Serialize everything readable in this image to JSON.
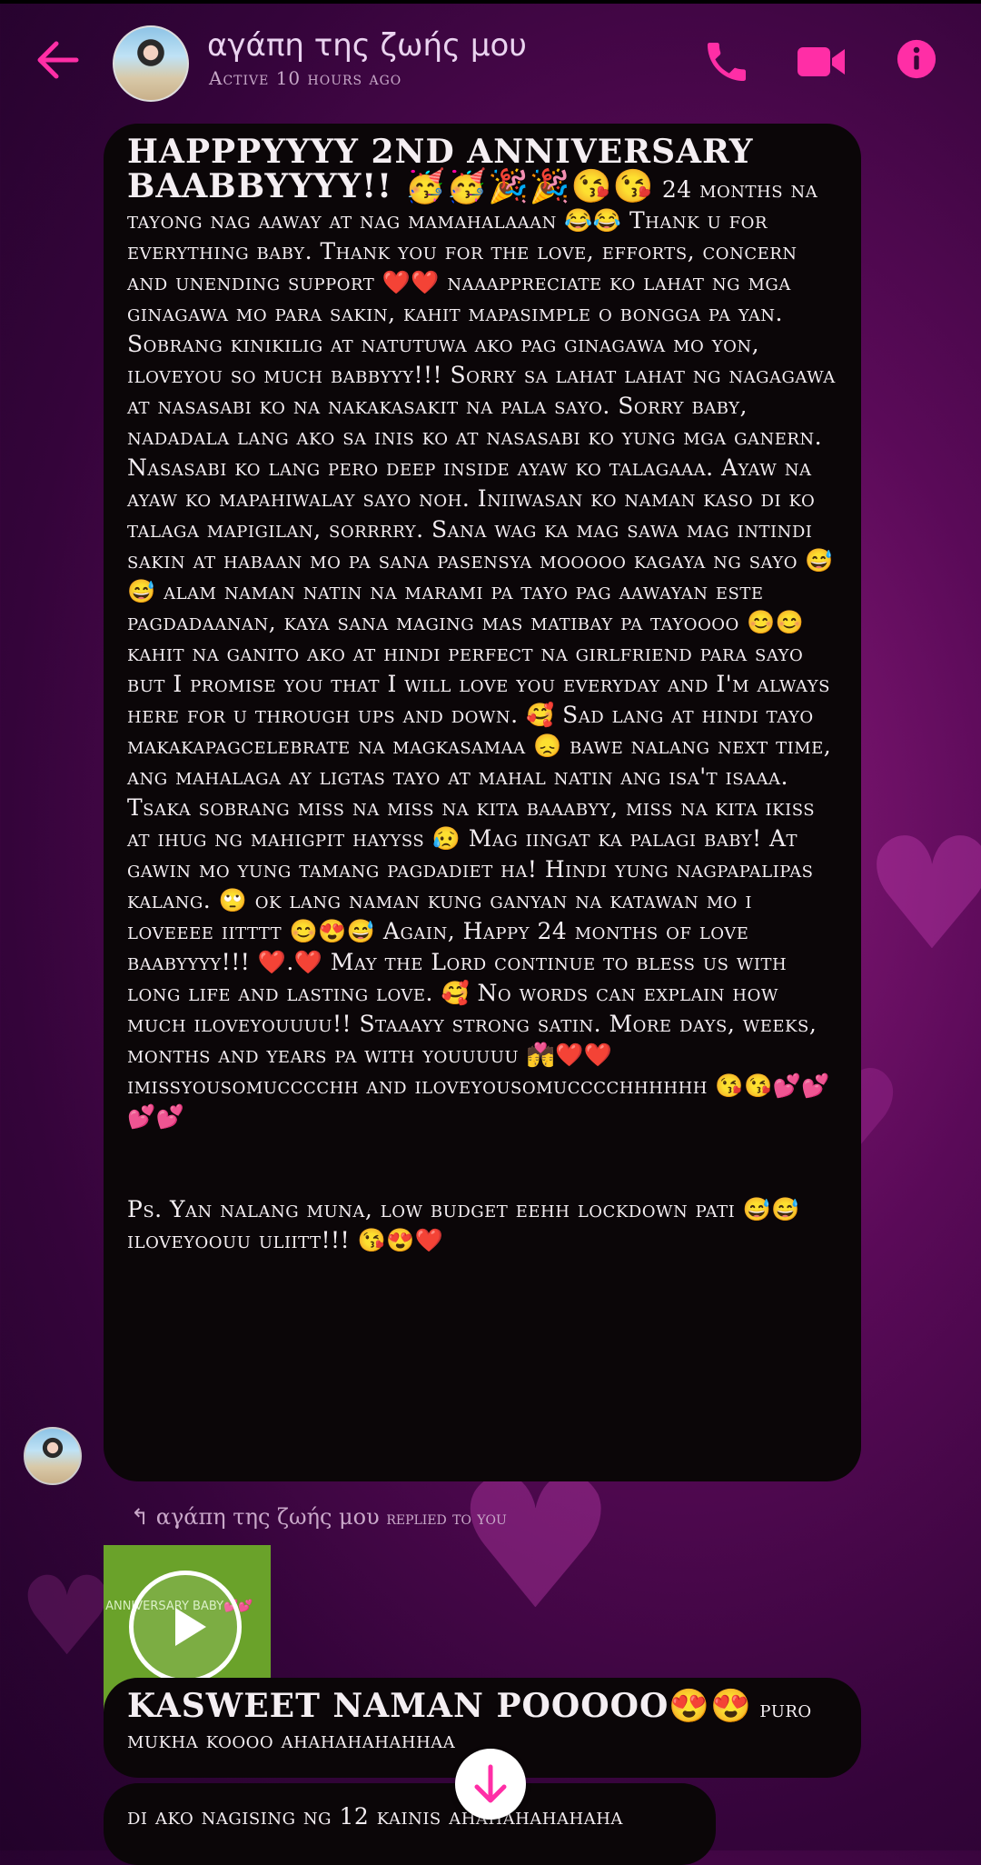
{
  "header": {
    "contact_name": "αγάπη της ζωής μου",
    "status": "Active 10 hours ago",
    "accent_color": "#ff2ea6"
  },
  "messages": {
    "anniversary": {
      "heading": "HAPPPYYYY 2ND ANNIVERSARY BAABBYYYY!! 🥳🥳🎉🎉😘😘",
      "body": " 24 months na tayong nag aaway at nag mamahalaaan 😂😂 Thank u for everything baby. Thank you for the love, efforts, concern and unending support ❤️❤️ naaappreciate ko lahat ng mga ginagawa mo para sakin, kahit mapasimple o bongga pa yan. Sobrang kinikilig at natutuwa ako pag ginagawa mo yon, iloveyou so much babbyyy!!! Sorry sa lahat lahat ng nagagawa at nasasabi ko na nakakasakit na pala sayo. Sorry baby, nadadala lang ako sa inis ko at nasasabi ko yung mga ganern. Nasasabi ko lang pero deep inside ayaw ko talagaaa. Ayaw na ayaw ko mapahiwalay sayo noh. Iniiwasan ko naman kaso di ko talaga mapigilan, sorrrry. Sana wag ka mag sawa mag intindi sakin at habaan mo pa sana pasensya mooooo kagaya ng sayo 😅😅 alam naman natin na marami pa tayo pag aawayan este pagdadaanan, kaya sana maging mas matibay pa tayoooo 😊😊 kahit na ganito ako at hindi perfect na girlfriend para sayo but I promise you that I will love you everyday and I'm always here for u through ups and down. 🥰 Sad lang at hindi tayo makakapagcelebrate na magkasamaa 😞 bawe nalang next time, ang mahalaga ay ligtas tayo at mahal natin ang isa't isaaa. Tsaka sobrang miss na miss na kita baaabyy, miss na kita ikiss at ihug ng mahigpit hayyss 😥 Mag iingat ka palagi baby! At gawin mo yung tamang pagdadiet ha! Hindi yung nagpapalipas kalang. 🙄 ok lang naman kung ganyan na katawan mo i loveeee iitttt 😊😍😅 Again, Happy 24 months of love baabyyyy!!! ❤️.❤️ May the Lord continue to bless us with long life and lasting love. 🥰 No words can explain how much iloveyouuuu!! Staaayy strong satin. More days, weeks, months and years pa with youuuuu 💏❤️❤️  imissyousomucccchh and iloveyousomucccchhhhhh 😘😘💕💕💕💕\n\n\nPs. Yan nalang muna, low budget eehh lockdown pati 😅😅 iloveyoouu uliitt!!! 😘😍❤️"
    },
    "reply_label": {
      "name": "αγάπη της ζωής μου",
      "suffix": "replied to you"
    },
    "video": {
      "overlay_text": "Y ANNIVERSARY BABY💕💕"
    },
    "reply_message": {
      "heading": "KASWEET NAMAN POOOOO😍😍",
      "body": " puro mukha koooo ahahahahahhaa"
    },
    "last_message": {
      "text": "di ako nagising ng 12 kainis ahahahahahaha"
    }
  }
}
